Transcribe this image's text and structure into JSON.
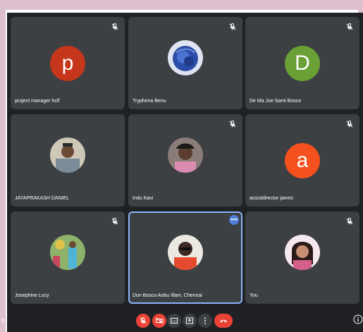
{
  "participants": [
    {
      "name": "project manager hclf",
      "initial": "p",
      "color": "#c5361b",
      "muted": true
    },
    {
      "name": "Tryphena Benu",
      "initial": "",
      "color": "#2f4fa0",
      "muted": true
    },
    {
      "name": "De Ma Joe Sami Bosco",
      "initial": "D",
      "color": "#6aa036",
      "muted": true
    },
    {
      "name": "JAYAPRAKASH DANIEL",
      "initial": "",
      "color": "#9a8b7e",
      "muted": false
    },
    {
      "name": "Indu Kavi",
      "initial": "",
      "color": "#6b6465",
      "muted": true
    },
    {
      "name": "assistdirector james",
      "initial": "a",
      "color": "#f4511e",
      "muted": true
    },
    {
      "name": "Josephine Lucy",
      "initial": "",
      "color": "#7bb3c9",
      "muted": true
    },
    {
      "name": "Don Bosco Anbu Illam, Chennai",
      "initial": "",
      "color": "#b6b0a8",
      "muted": false
    },
    {
      "name": "You",
      "initial": "",
      "color": "#c9879a",
      "muted": true
    }
  ],
  "controls": {
    "mic": "mic-off",
    "camera": "camera-off",
    "captions": "captions",
    "present": "present",
    "more": "more",
    "end": "end-call"
  },
  "footer": {
    "left_text": "b"
  }
}
